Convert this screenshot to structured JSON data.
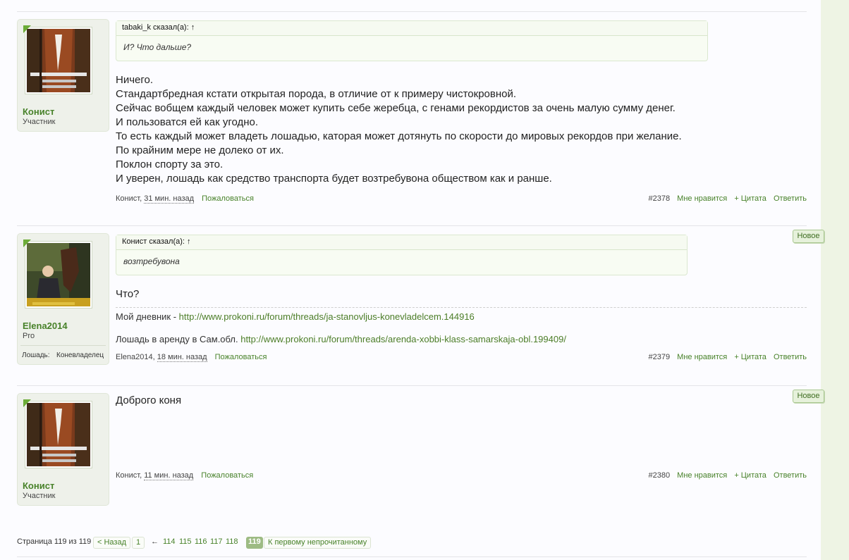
{
  "posts": [
    {
      "author": "Конист",
      "role": "Участник",
      "quote": {
        "header": "tabaki_k сказал(а): ↑",
        "text": "И? Что дальше?"
      },
      "lines": [
        "Ничего.",
        "Стандартбредная кстати открытая порода, в отличие от к примеру чистокровной.",
        "Сейчас вобщем каждый человек может купить себе жеребца, с генами рекордистов за очень малую сумму денег.",
        "И пользоватся ей как угодно.",
        "То есть каждый может владеть лошадью, каторая может дотянуть по скорости до мировых рекордов при желание.",
        "По крайним мере не долеко от их.",
        "Поклон спорту за это.",
        "И уверен, лошадь как средство транспорта будет возтребувона обществом как и ранше."
      ],
      "time": "31 мин. назад",
      "report": "Пожаловаться",
      "number": "#2378",
      "like": "Мне нравится",
      "quote_btn": "+ Цитата",
      "reply": "Ответить"
    },
    {
      "author": "Elena2014",
      "role": "Pro",
      "extra_label": "Лошадь:",
      "extra_value": "Коневладелец",
      "badge": "Новое",
      "quote": {
        "header": "Конист сказал(а): ↑",
        "text": "возтребувона"
      },
      "lines": [
        "Что?"
      ],
      "sig1_prefix": "Мой дневник - ",
      "sig1_link": "http://www.prokoni.ru/forum/threads/ja-stanovljus-konevladelcem.144916",
      "sig2_prefix": "Лошадь в аренду в Сам.обл. ",
      "sig2_link": "http://www.prokoni.ru/forum/threads/arenda-xobbi-klass-samarskaja-obl.199409/",
      "time": "18 мин. назад",
      "report": "Пожаловаться",
      "number": "#2379",
      "like": "Мне нравится",
      "quote_btn": "+ Цитата",
      "reply": "Ответить"
    },
    {
      "author": "Конист",
      "role": "Участник",
      "badge": "Новое",
      "lines": [
        "Доброго коня"
      ],
      "time": "11 мин. назад",
      "report": "Пожаловаться",
      "number": "#2380",
      "like": "Мне нравится",
      "quote_btn": "+ Цитата",
      "reply": "Ответить"
    }
  ],
  "pagination": {
    "label": "Страница 119 из 119",
    "prev": "< Назад",
    "first": "1",
    "ellipsis": "←",
    "pages": [
      "114",
      "115",
      "116",
      "117",
      "118"
    ],
    "current": "119",
    "unread": "К первому непрочитанному"
  }
}
